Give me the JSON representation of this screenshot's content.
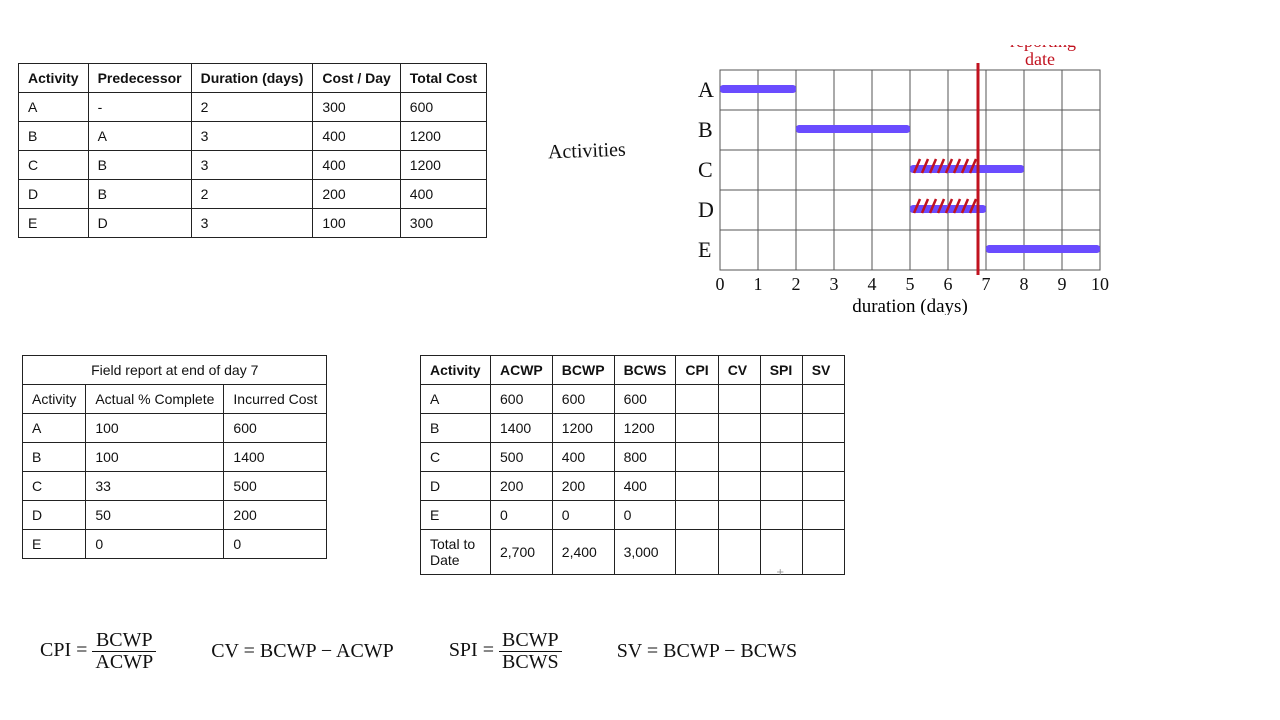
{
  "activity_table": {
    "headers": [
      "Activity",
      "Predecessor",
      "Duration (days)",
      "Cost / Day",
      "Total Cost"
    ],
    "rows": [
      [
        "A",
        "-",
        "2",
        "300",
        "600"
      ],
      [
        "B",
        "A",
        "3",
        "400",
        "1200"
      ],
      [
        "C",
        "B",
        "3",
        "400",
        "1200"
      ],
      [
        "D",
        "B",
        "2",
        "200",
        "400"
      ],
      [
        "E",
        "D",
        "3",
        "100",
        "300"
      ]
    ]
  },
  "activities_label": "Activities",
  "gantt": {
    "row_labels": [
      "A",
      "B",
      "C",
      "D",
      "E"
    ],
    "x_label": "duration (days)",
    "x_ticks": [
      "0",
      "1",
      "2",
      "3",
      "4",
      "5",
      "6",
      "7",
      "8",
      "9",
      "10"
    ],
    "reporting_date_label": "reporting\ndate",
    "reporting_x": 6.8
  },
  "chart_data": {
    "type": "bar",
    "orientation": "horizontal",
    "categories": [
      "A",
      "B",
      "C",
      "D",
      "E"
    ],
    "series": [
      {
        "name": "activity-duration",
        "start": [
          0,
          2,
          5,
          5,
          7
        ],
        "end": [
          2,
          5,
          8,
          7,
          10
        ]
      },
      {
        "name": "hatched-progress",
        "start": [
          null,
          null,
          5,
          5,
          null
        ],
        "end": [
          null,
          null,
          6.8,
          6.8,
          null
        ]
      }
    ],
    "xlabel": "duration (days)",
    "xlim": [
      0,
      10
    ],
    "reporting_date": 6.8,
    "tick_labels": [
      0,
      1,
      2,
      3,
      4,
      5,
      6,
      7,
      8,
      9,
      10
    ]
  },
  "field_report": {
    "title": "Field report at end of day 7",
    "headers": [
      "Activity",
      "Actual % Complete",
      "Incurred Cost"
    ],
    "rows": [
      [
        "A",
        "100",
        "600"
      ],
      [
        "B",
        "100",
        "1400"
      ],
      [
        "C",
        "33",
        "500"
      ],
      [
        "D",
        "50",
        "200"
      ],
      [
        "E",
        "0",
        "0"
      ]
    ]
  },
  "earned_table": {
    "headers": [
      "Activity",
      "ACWP",
      "BCWP",
      "BCWS",
      "CPI",
      "CV",
      "SPI",
      "SV"
    ],
    "rows": [
      [
        "A",
        "600",
        "600",
        "600",
        "",
        "",
        "",
        ""
      ],
      [
        "B",
        "1400",
        "1200",
        "1200",
        "",
        "",
        "",
        ""
      ],
      [
        "C",
        "500",
        "400",
        "800",
        "",
        "",
        "",
        ""
      ],
      [
        "D",
        "200",
        "200",
        "400",
        "",
        "",
        "",
        ""
      ],
      [
        "E",
        "0",
        "0",
        "0",
        "",
        "",
        "",
        ""
      ],
      [
        "Total to Date",
        "2,700",
        "2,400",
        "3,000",
        "",
        "",
        "",
        ""
      ]
    ]
  },
  "formulas": {
    "cpi_lhs": "CPI =",
    "cpi_num": "BCWP",
    "cpi_den": "ACWP",
    "cv": "CV = BCWP − ACWP",
    "spi_lhs": "SPI =",
    "spi_num": "BCWP",
    "spi_den": "BCWS",
    "sv": "SV = BCWP − BCWS"
  }
}
